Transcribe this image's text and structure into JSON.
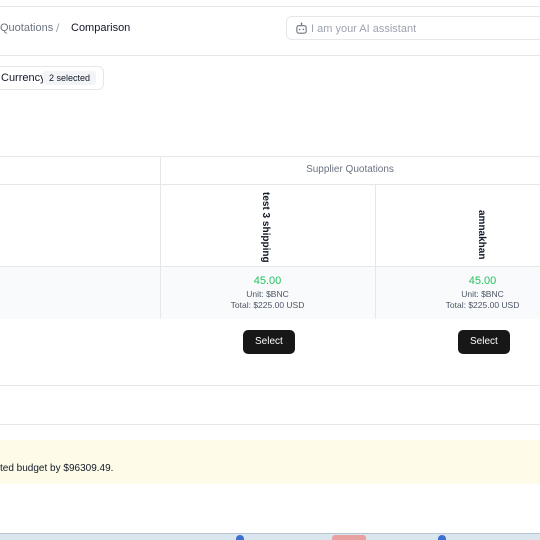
{
  "breadcrumb": {
    "previous": "Quotations",
    "separator": "/",
    "current": "Comparison"
  },
  "assistant": {
    "placeholder": "I am your AI assistant",
    "icon": "bot-icon"
  },
  "filter": {
    "label": "Currency",
    "badge": "2 selected"
  },
  "table": {
    "group_header": "Supplier Quotations",
    "suppliers": [
      {
        "name": "test 3 shipping",
        "price": "45.00",
        "unit": "Unit: $BNC",
        "total": "Total: $225.00 USD",
        "action": "Select"
      },
      {
        "name": "amnakhan",
        "price": "45.00",
        "unit": "Unit: $BNC",
        "total": "Total: $225.00 USD",
        "action": "Select"
      }
    ]
  },
  "notice": {
    "text": "ted budget by $96309.49."
  },
  "colors": {
    "price_green": "#22c55e",
    "button_bg": "#171717",
    "notice_bg": "#fefce8"
  }
}
